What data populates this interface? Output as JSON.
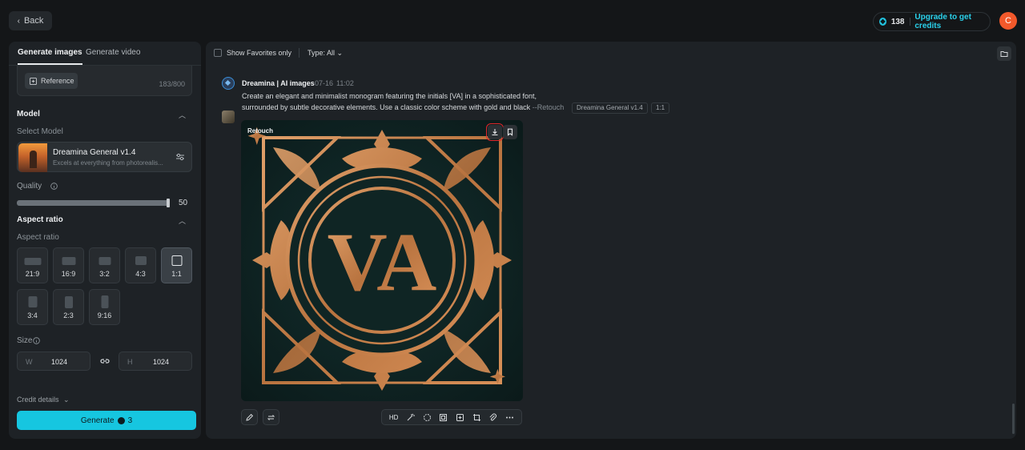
{
  "header": {
    "back_label": "Back",
    "credits_count": "138",
    "upgrade_label": "Upgrade to get credits",
    "avatar_initial": "C"
  },
  "sidebar": {
    "tabs": [
      {
        "label": "Generate images",
        "active": true
      },
      {
        "label": "Generate video",
        "active": false
      }
    ],
    "reference_label": "Reference",
    "char_counter": "183/800",
    "model_section_title": "Model",
    "select_model_label": "Select Model",
    "model": {
      "name": "Dreamina General v1.4",
      "description": "Excels at everything from photorealis..."
    },
    "quality_label": "Quality",
    "quality_value": "50",
    "quality_fraction": 0.98,
    "aspect_section_title": "Aspect ratio",
    "aspect_sub_label": "Aspect ratio",
    "aspect_ratios": [
      {
        "label": "21:9",
        "selected": false
      },
      {
        "label": "16:9",
        "selected": false
      },
      {
        "label": "3:2",
        "selected": false
      },
      {
        "label": "4:3",
        "selected": false
      },
      {
        "label": "1:1",
        "selected": true
      },
      {
        "label": "3:4",
        "selected": false
      },
      {
        "label": "2:3",
        "selected": false
      },
      {
        "label": "9:16",
        "selected": false
      }
    ],
    "size_label": "Size",
    "width_prefix": "W",
    "width_value": "1024",
    "height_prefix": "H",
    "height_value": "1024",
    "credit_details_label": "Credit details",
    "generate_label": "Generate",
    "generate_cost": "3"
  },
  "main": {
    "favorites_label": "Show Favorites only",
    "type_filter_label": "Type: All",
    "entry": {
      "author": "Dreamina | AI images",
      "date": "07-16",
      "time": "11:02",
      "prompt_line1": "Create an elegant and minimalist monogram featuring the initials [VA] in a sophisticated font,",
      "prompt_line2": "surrounded by subtle decorative elements. Use a classic color scheme with gold and black",
      "retouch_suffix": "--Retouch",
      "model_tag": "Dreamina General v1.4",
      "ratio_tag": "1:1",
      "image_label": "Retouch",
      "monogram_text": "VA"
    },
    "toolbar": {
      "hd_label": "HD"
    }
  },
  "colors": {
    "accent": "#16c6e0",
    "avatar": "#f2592b",
    "gold": "#c8844c",
    "highlight": "#e0262b"
  }
}
